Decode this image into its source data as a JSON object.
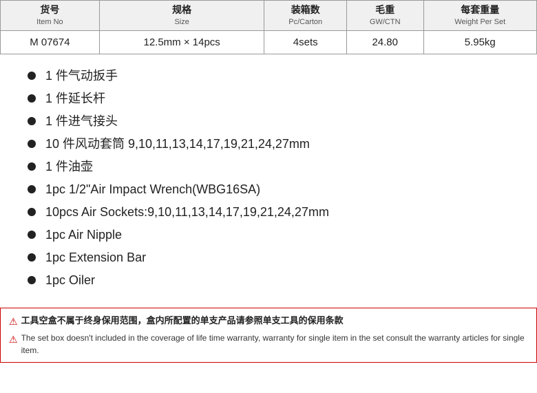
{
  "table": {
    "headers": [
      {
        "main": "货号",
        "sub": "Item No"
      },
      {
        "main": "规格",
        "sub": "Size"
      },
      {
        "main": "装箱数",
        "sub": "Pc/Carton"
      },
      {
        "main": "毛重",
        "sub": "GW/CTN"
      },
      {
        "main": "每套重量",
        "sub": "Weight Per Set"
      }
    ],
    "row": {
      "item_no": "M 07674",
      "size": "12.5mm × 14pcs",
      "pc_carton": "4sets",
      "gw_ctn": "24.80",
      "weight_per_set": "5.95kg"
    }
  },
  "bullet_items": [
    {
      "text": "1 件气动扳手"
    },
    {
      "text": "1 件延长杆"
    },
    {
      "text": "1 件进气接头"
    },
    {
      "text": "10 件风动套筒 9,10,11,13,14,17,19,21,24,27mm"
    },
    {
      "text": "1 件油壶"
    },
    {
      "text": "1pc      1/2\"Air Impact Wrench(WBG16SA)"
    },
    {
      "text": "10pcs   Air Sockets:9,10,11,13,14,17,19,21,24,27mm"
    },
    {
      "text": "1pc       Air Nipple"
    },
    {
      "text": "1pc     Extension Bar"
    },
    {
      "text": "1pc    Oiler"
    }
  ],
  "warnings": {
    "line1_cn": "工具空盒不属于终身保用范围，盒内所配置的单支产品请参照单支工具的保用条款",
    "line2_en": "The set box doesn't included in the coverage of life time warranty, warranty for single item in the set consult the warranty articles for single item."
  }
}
